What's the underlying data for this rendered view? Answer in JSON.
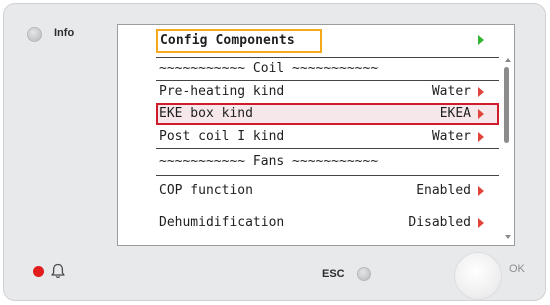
{
  "device": {
    "info_label": "Info",
    "esc_label": "ESC",
    "ok_label": "OK"
  },
  "screen": {
    "title": "Config Components",
    "rows": [
      {
        "label": "~~~~~~~~~~~ Coil ~~~~~~~~~~~",
        "value": "",
        "arrow": false,
        "selected": false
      },
      {
        "label": "Pre-heating kind",
        "value": "Water",
        "arrow": true,
        "selected": false
      },
      {
        "label": "EKE box kind",
        "value": "EKEA",
        "arrow": true,
        "selected": true
      },
      {
        "label": "Post coil I kind",
        "value": "Water",
        "arrow": true,
        "selected": false
      },
      {
        "label": "~~~~~~~~~~~ Fans ~~~~~~~~~~~",
        "value": "",
        "arrow": false,
        "selected": false
      },
      {
        "label": "COP function",
        "value": "Enabled",
        "arrow": true,
        "selected": false
      },
      {
        "label": "Dehumidification",
        "value": "Disabled",
        "arrow": true,
        "selected": false
      }
    ]
  },
  "colors": {
    "title_highlight": "#f5a91b",
    "selection_border": "#d01b2a",
    "arrow_red": "#e0453d",
    "arrow_green": "#2fb52f",
    "alarm_led": "#e11d1d"
  },
  "icons": [
    "info-led-icon",
    "bell-icon",
    "alarm-led-icon",
    "esc-led-icon",
    "ok-button-icon",
    "play-arrow-icon"
  ]
}
